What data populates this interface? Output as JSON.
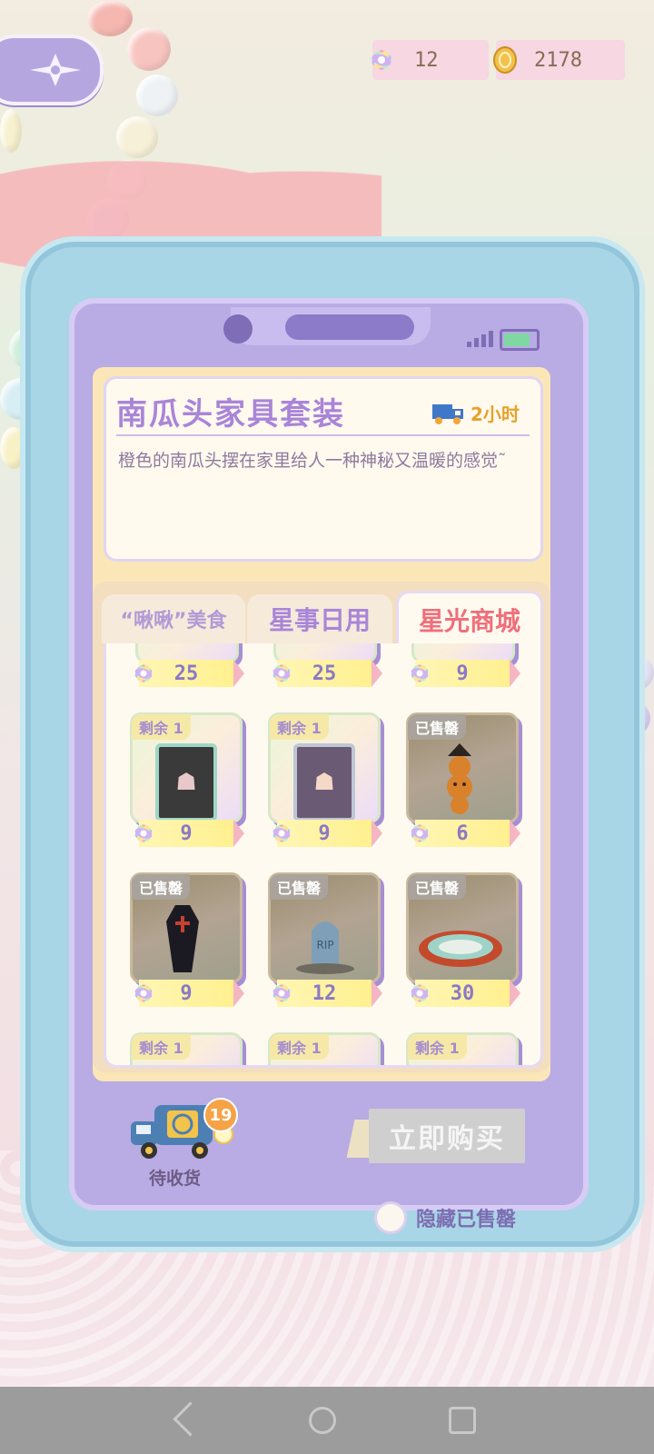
{
  "header": {
    "back_icon": "compass-star-icon",
    "gem_count": "12",
    "coin_count": "2178"
  },
  "product": {
    "title": "南瓜头家具套装",
    "delivery_time": "2小时",
    "description": "橙色的南瓜头摆在家里给人一种神秘又温暖的感觉˜"
  },
  "tabs": [
    {
      "label": "“啾啾”美食"
    },
    {
      "label": "星事日用"
    },
    {
      "label": "星光商城",
      "active": true
    }
  ],
  "shop": {
    "top_row_prices": [
      "25",
      "25",
      "9"
    ],
    "items": [
      {
        "status": "剩余 1",
        "price": "9",
        "sold": false,
        "icon": "card-icon"
      },
      {
        "status": "剩余 1",
        "price": "9",
        "sold": false,
        "icon": "card-icon"
      },
      {
        "status": "已售罄",
        "price": "6",
        "sold": true,
        "icon": "pumpkin-icon"
      },
      {
        "status": "已售罄",
        "price": "9",
        "sold": true,
        "icon": "coffin-icon"
      },
      {
        "status": "已售罄",
        "price": "12",
        "sold": true,
        "icon": "gravestone-icon"
      },
      {
        "status": "已售罄",
        "price": "30",
        "sold": true,
        "icon": "rug-icon"
      }
    ],
    "bottom_row_badges": [
      "剩余 1",
      "剩余 1",
      "剩余 1"
    ]
  },
  "footer": {
    "pending_label": "待收货",
    "pending_count": "19",
    "buy_label": "立即购买",
    "hide_sold_label": "隐藏已售罄"
  },
  "colors": {
    "accent": "#a985d8",
    "active_tab": "#f06f7a",
    "price_bar": "#fff08f",
    "sold_badge": "#a9a39b"
  }
}
